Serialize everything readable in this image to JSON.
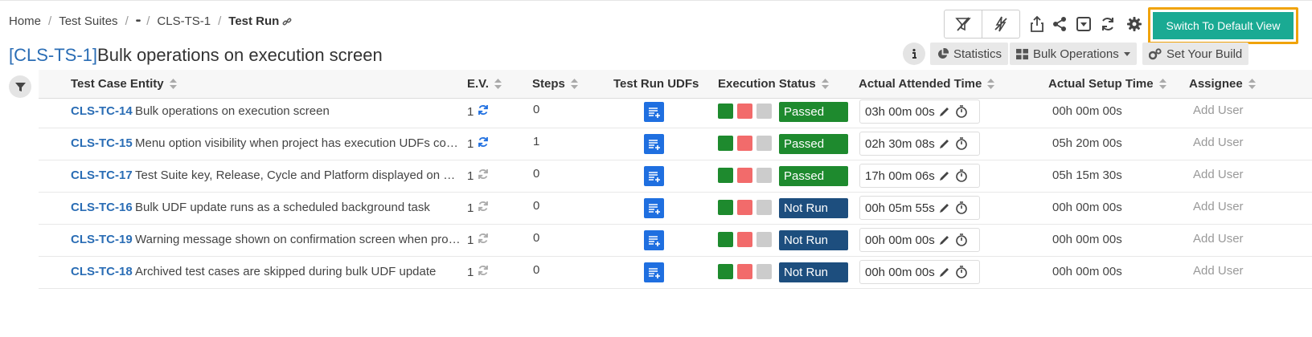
{
  "breadcrumb": {
    "items": [
      "Home",
      "Test Suites",
      "•••",
      "CLS-TS-1"
    ],
    "current": "Test Run"
  },
  "title": {
    "key": "[CLS-TS-1]",
    "text": "Bulk operations on execution screen"
  },
  "toolbar": {
    "switch_label": "Switch To Default View",
    "statistics_label": "Statistics",
    "bulk_label": "Bulk Operations",
    "build_label": "Set Your Build"
  },
  "colors": {
    "accent": "#1aaa93",
    "highlight": "#f0a30a",
    "link": "#2a6db5",
    "passed": "#1e8a2e",
    "notrun": "#1d4e7e",
    "pass_square": "#1e8a2e",
    "fail_square": "#f26b6b",
    "skip_square": "#cccccc"
  },
  "table": {
    "headers": {
      "entity": "Test Case Entity",
      "ev": "E.V.",
      "steps": "Steps",
      "udfs": "Test Run UDFs",
      "status": "Execution Status",
      "attended": "Actual Attended Time",
      "setup": "Actual Setup Time",
      "assignee": "Assignee"
    },
    "rows": [
      {
        "key": "CLS-TC-14",
        "name": "Bulk operations on execution screen",
        "ev": "1",
        "ev_sync": true,
        "steps": "0",
        "status": "Passed",
        "attended": "03h 00m 00s",
        "setup": "00h 00m 00s",
        "assignee": "Add User"
      },
      {
        "key": "CLS-TC-15",
        "name": "Menu option visibility when project has execution UDFs configured",
        "ev": "1",
        "ev_sync": true,
        "steps": "1",
        "status": "Passed",
        "attended": "02h 30m 08s",
        "setup": "05h 20m 00s",
        "assignee": "Add User"
      },
      {
        "key": "CLS-TC-17",
        "name": "Test Suite key, Release, Cycle and Platform displayed on bulk update",
        "ev": "1",
        "ev_sync": false,
        "steps": "0",
        "status": "Passed",
        "attended": "17h 00m 06s",
        "setup": "05h 15m 30s",
        "assignee": "Add User"
      },
      {
        "key": "CLS-TC-16",
        "name": "Bulk UDF update runs as a scheduled background task",
        "ev": "1",
        "ev_sync": false,
        "steps": "0",
        "status": "Not Run",
        "attended": "00h 05m 55s",
        "setup": "00h 00m 00s",
        "assignee": "Add User"
      },
      {
        "key": "CLS-TC-19",
        "name": "Warning message shown on confirmation screen when processing",
        "ev": "1",
        "ev_sync": false,
        "steps": "0",
        "status": "Not Run",
        "attended": "00h 00m 00s",
        "setup": "00h 00m 00s",
        "assignee": "Add User"
      },
      {
        "key": "CLS-TC-18",
        "name": "Archived test cases are skipped during bulk UDF update",
        "ev": "1",
        "ev_sync": false,
        "steps": "0",
        "status": "Not Run",
        "attended": "00h 00m 00s",
        "setup": "00h 00m 00s",
        "assignee": "Add User"
      }
    ]
  }
}
